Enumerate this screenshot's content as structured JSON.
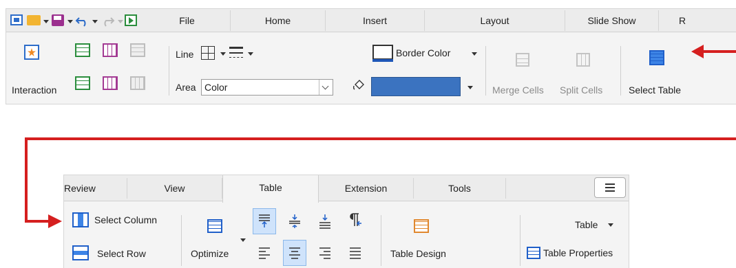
{
  "top": {
    "tabs": [
      "File",
      "Home",
      "Insert",
      "Layout",
      "Slide Show",
      "R"
    ],
    "interaction_label": "Interaction",
    "line_label": "Line",
    "area_label": "Area",
    "area_value": "Color",
    "border_color_label": "Border Color",
    "merge_cells_label": "Merge Cells",
    "split_cells_label": "Split Cells",
    "select_table_label": "Select Table",
    "fill_color": "#3b73c0"
  },
  "bottom": {
    "tabs": [
      "Review",
      "View",
      "Table",
      "Extension",
      "Tools"
    ],
    "select_column_label": "Select Column",
    "select_row_label": "Select Row",
    "optimize_label": "Optimize",
    "table_design_label": "Table Design",
    "table_dropdown_label": "Table",
    "table_properties_label": "Table Properties",
    "menu_icon": "hamburger-icon"
  },
  "colors": {
    "arrow": "#d51f1f",
    "accent": "#2e75d4",
    "highlight": "#cfe3fb"
  }
}
